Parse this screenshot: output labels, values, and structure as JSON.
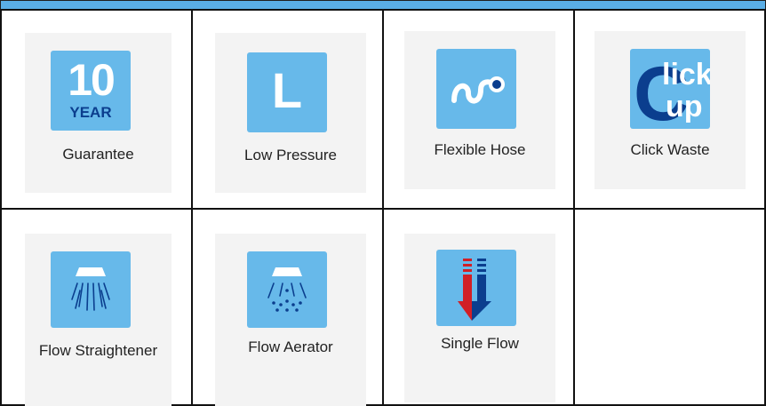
{
  "features": [
    {
      "label": "Guarantee",
      "icon": "ten-year-guarantee-icon",
      "badge_number": "10",
      "badge_text": "YEAR"
    },
    {
      "label": "Low Pressure",
      "icon": "low-pressure-icon",
      "badge_letter": "L"
    },
    {
      "label": "Flexible Hose",
      "icon": "flexible-hose-icon"
    },
    {
      "label": "Click Waste",
      "icon": "click-up-waste-icon"
    },
    {
      "label": "Flow Straightener",
      "icon": "flow-straightener-icon"
    },
    {
      "label": "Flow Aerator",
      "icon": "flow-aerator-icon"
    },
    {
      "label": "Single Flow",
      "icon": "single-flow-icon"
    }
  ],
  "colors": {
    "header_bar": "#5aaee6",
    "icon_tile": "#67b9ea",
    "dark_blue": "#0b3e8e",
    "red": "#d11f26"
  }
}
